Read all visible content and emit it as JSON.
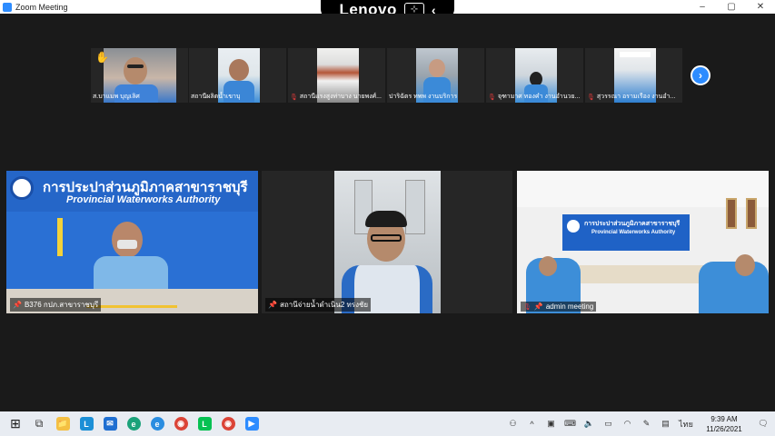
{
  "window": {
    "title": "Zoom Meeting",
    "controls": [
      "–",
      "▢",
      "✕"
    ]
  },
  "overlay": {
    "brand": "Lenovo",
    "chevron": "‹"
  },
  "thumbnails": [
    {
      "name": "ส.บาแมพ บุญเลิศ",
      "hand_raised": true,
      "muted": false
    },
    {
      "name": "สถานีผลิตน้ำเขาบุ",
      "hand_raised": false,
      "muted": false
    },
    {
      "name": "สถานีแรงสูงท่าบาง นายพงศ์...",
      "hand_raised": false,
      "muted": true
    },
    {
      "name": "ปาริฉัตร ทพพ งานบริการ",
      "hand_raised": false,
      "muted": false
    },
    {
      "name": "จุฑามาศ ทองคำ งานอำนวย...",
      "hand_raised": false,
      "muted": true
    },
    {
      "name": "สุวรรณา อรามเรือง งานอำ...",
      "hand_raised": false,
      "muted": true
    }
  ],
  "next_button": "›",
  "tiles": [
    {
      "name": "B376 กปภ.สาขาราชบุรี",
      "banner_th": "การประปาส่วนภูมิภาคสาขาราชบุรี",
      "banner_en": "Provincial Waterworks Authority",
      "muted": false
    },
    {
      "name": "สถานีจ่ายน้ำดำเนิน2 ทรงชัย",
      "muted": false
    },
    {
      "name": "admin meeting",
      "banner_th": "การประปาส่วนภูมิภาคสาขาราชบุรี",
      "banner_en": "Provincial Waterworks Authority",
      "muted": true
    }
  ],
  "taskbar": {
    "apps": [
      {
        "icon": "windows-start-icon",
        "glyph": "⊞"
      },
      {
        "icon": "task-view-icon",
        "glyph": "⧉"
      },
      {
        "icon": "file-explorer-icon",
        "glyph": "📁"
      },
      {
        "icon": "lingo-app-icon",
        "glyph": "L"
      },
      {
        "icon": "mail-icon",
        "glyph": "✉"
      },
      {
        "icon": "edge-icon",
        "glyph": "e"
      },
      {
        "icon": "ie-icon",
        "glyph": "e"
      },
      {
        "icon": "chrome-icon",
        "glyph": "◉"
      },
      {
        "icon": "line-icon",
        "glyph": "L"
      },
      {
        "icon": "chrome-profile-icon",
        "glyph": "◉"
      },
      {
        "icon": "zoom-icon",
        "glyph": "▶"
      }
    ],
    "tray": [
      "⚇",
      "^",
      "▣",
      "⌨",
      "🔈",
      "▭",
      "◠",
      "✎",
      "▤",
      "ไทย"
    ],
    "time": "9:39 AM",
    "date": "11/26/2021",
    "notification_glyph": "🗨"
  },
  "colors": {
    "accent": "#2d8cff",
    "pwa_blue": "#1f6fd1",
    "muted_red": "#e03a3a"
  }
}
